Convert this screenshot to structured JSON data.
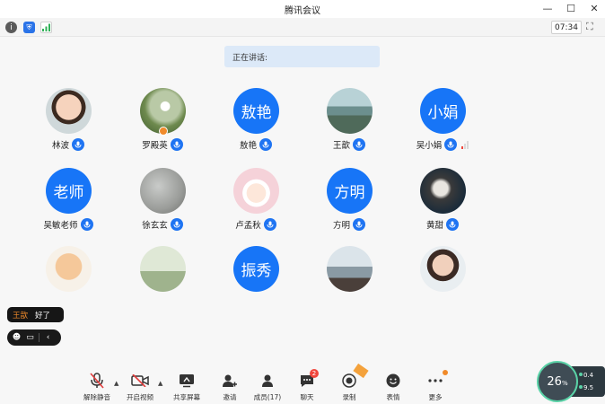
{
  "window": {
    "title": "腾讯会议"
  },
  "timer": "07:34",
  "speaking_label": "正在讲话:",
  "colors": {
    "accent": "#1775f7",
    "host_badge": "#f08a2a"
  },
  "participants": [
    {
      "name": "林波",
      "avatar": "photo-child",
      "avatar_text": ""
    },
    {
      "name": "罗殿英",
      "avatar": "photo-dandelion",
      "avatar_text": "",
      "host": true
    },
    {
      "name": "敖艳",
      "avatar": "blue",
      "avatar_text": "敖艳"
    },
    {
      "name": "王歆",
      "avatar": "photo-landscape",
      "avatar_text": ""
    },
    {
      "name": "吴小娟",
      "avatar": "blue",
      "avatar_text": "小娟",
      "signal": true
    },
    {
      "name": "吴敏老师",
      "avatar": "blue",
      "avatar_text": "老师"
    },
    {
      "name": "徐玄玄",
      "avatar": "photo-grey",
      "avatar_text": ""
    },
    {
      "name": "卢孟秋",
      "avatar": "photo-cartoon",
      "avatar_text": ""
    },
    {
      "name": "方明",
      "avatar": "blue",
      "avatar_text": "方明"
    },
    {
      "name": "黄甜",
      "avatar": "photo-tiger",
      "avatar_text": ""
    },
    {
      "name": "",
      "avatar": "photo-baby",
      "avatar_text": ""
    },
    {
      "name": "",
      "avatar": "photo-bike",
      "avatar_text": ""
    },
    {
      "name": "",
      "avatar": "blue",
      "avatar_text": "振秀"
    },
    {
      "name": "",
      "avatar": "photo-sea",
      "avatar_text": ""
    },
    {
      "name": "",
      "avatar": "photo-woman",
      "avatar_text": ""
    }
  ],
  "chat": {
    "sender": "王歆",
    "message": "好了"
  },
  "toolbar": {
    "unmute": "解除静音",
    "start_video": "开启视频",
    "share_screen": "共享屏幕",
    "invite": "邀请",
    "members": "成员(17)",
    "chat": "聊天",
    "chat_badge": "2",
    "record": "录制",
    "reactions": "表情",
    "more": "更多"
  },
  "network": {
    "percent": "26",
    "unit": "%",
    "upload": "0.4",
    "download": "9.5"
  }
}
